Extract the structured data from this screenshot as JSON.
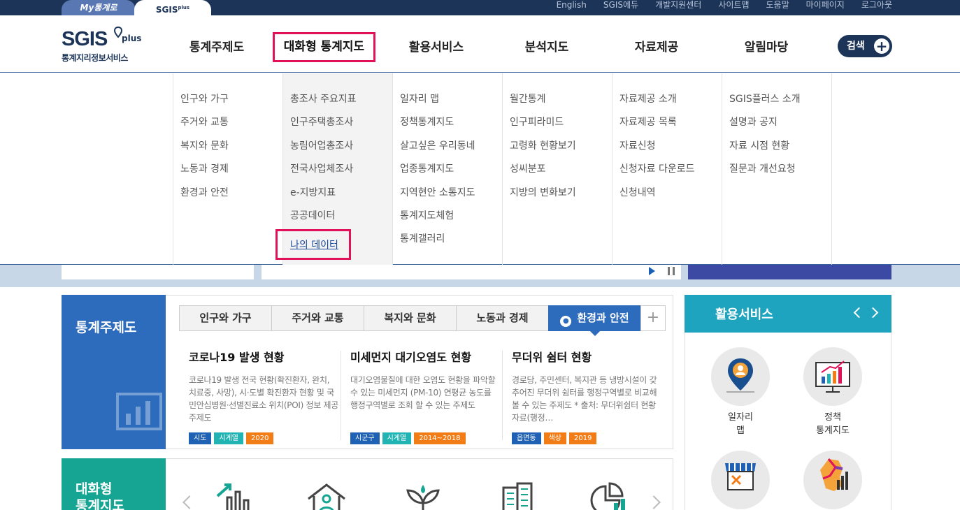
{
  "top": {
    "my_tab": "My통계로",
    "sgis_tab": "SGIS",
    "sgis_tab_sup": "plus",
    "links": [
      "English",
      "SGIS에듀",
      "개발지원센터",
      "사이트맵",
      "도움말",
      "마이페이지",
      "로그아웃"
    ]
  },
  "logo": {
    "main": "SGIS",
    "plus": "plus",
    "sub": "통계지리정보서비스"
  },
  "gnb": {
    "items": [
      "통계주제도",
      "대화형 통계지도",
      "활용서비스",
      "분석지도",
      "자료제공",
      "알림마당"
    ],
    "active": "대화형 통계지도",
    "search_label": "검색"
  },
  "mega": {
    "col1": [
      "인구와 가구",
      "주거와 교통",
      "복지와 문화",
      "노동과 경제",
      "환경과 안전"
    ],
    "col2": [
      "총조사 주요지표",
      "인구주택총조사",
      "농림어업총조사",
      "전국사업체조사",
      "e-지방지표",
      "공공데이터"
    ],
    "col2_highlight": "나의 데이터",
    "col3": [
      "일자리 맵",
      "정책통계지도",
      "살고싶은 우리동네",
      "업종통계지도",
      "지역현안 소통지도",
      "통계지도체험",
      "통계갤러리"
    ],
    "col4": [
      "월간통계",
      "인구피라미드",
      "고령화 현황보기",
      "성씨분포",
      "지방의 변화보기"
    ],
    "col5": [
      "자료제공 소개",
      "자료제공 목록",
      "자료신청",
      "신청자료 다운로드",
      "신청내역"
    ],
    "col6": [
      "SGIS플러스 소개",
      "설명과 공지",
      "자료 시점 현황",
      "질문과 개선요청"
    ]
  },
  "theme": {
    "title": "통계주제도",
    "tabs": [
      "인구와 가구",
      "주거와 교통",
      "복지와 문화",
      "노동과 경제",
      "환경과 안전"
    ],
    "active_tab": "환경과 안전",
    "plus": "+",
    "articles": [
      {
        "title": "코로나19 발생 현황",
        "desc": "코로나19 발생 전국 현황(확진환자, 완치, 치료중, 사망), 시·도별 확진환자 현황 및 국민안심병원·선별진료소 위치(POI) 정보 제공 주제도",
        "badges": [
          "시도",
          "시계열",
          "2020"
        ]
      },
      {
        "title": "미세먼지 대기오염도 현황",
        "desc": "대기오염물질에 대한 오염도 현황을 파악할수 있는 미세먼지 (PM-10) 연평균 농도를 행정구역별로 조회 할 수 있는 주제도",
        "badges": [
          "시군구",
          "시계열",
          "2014~2018"
        ]
      },
      {
        "title": "무더위 쉼터 현황",
        "desc": "경로당, 주민센터, 복지관 등 냉방시설이 갖추어진 무더위 쉼터를 행정구역별로 비교해 볼 수 있는 주제도 * 출처: 무더위쉼터 현황자료(행정…",
        "badges": [
          "읍면동",
          "색상",
          "2019"
        ]
      }
    ]
  },
  "interactive": {
    "title_line1": "대화형",
    "title_line2": "통계지도"
  },
  "services": {
    "title": "활용서비스",
    "items": [
      {
        "line1": "일자리",
        "line2": "맵"
      },
      {
        "line1": "정책",
        "line2": "통계지도"
      }
    ]
  },
  "colors": {
    "navy": "#1c3458",
    "highlight": "#e2125a",
    "theme_blue": "#2d6bbc",
    "interactive_green": "#16a592",
    "service_teal": "#1fa4bf"
  }
}
